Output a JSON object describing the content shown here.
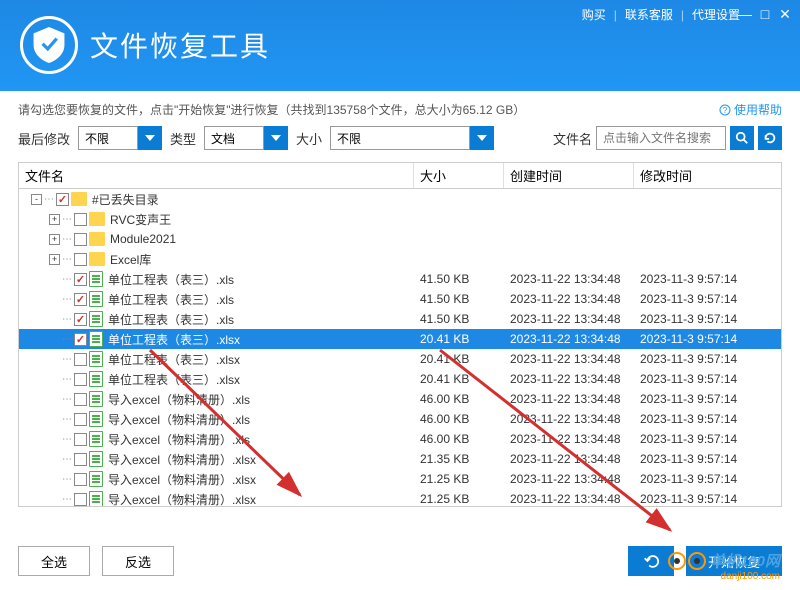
{
  "top_links": {
    "buy": "购买",
    "contact": "联系客服",
    "proxy": "代理设置"
  },
  "app_title": "文件恢复工具",
  "hint": "请勾选您要恢复的文件，点击\"开始恢复\"进行恢复（共找到135758个文件，总大小为65.12 GB）",
  "help": "使用帮助",
  "filters": {
    "last_modified_label": "最后修改",
    "last_modified_value": "不限",
    "type_label": "类型",
    "type_value": "文档",
    "size_label": "大小",
    "size_value": "不限",
    "filename_label": "文件名",
    "search_placeholder": "点击输入文件名搜索"
  },
  "columns": {
    "name": "文件名",
    "size": "大小",
    "created": "创建时间",
    "modified": "修改时间"
  },
  "tree": [
    {
      "depth": 0,
      "type": "folder",
      "expand": "-",
      "checked": true,
      "name": "#已丢失目录",
      "size": "",
      "created": "",
      "modified": "",
      "selected": false
    },
    {
      "depth": 1,
      "type": "folder",
      "expand": "+",
      "checked": false,
      "name": "RVC变声王",
      "size": "",
      "created": "",
      "modified": "",
      "selected": false
    },
    {
      "depth": 1,
      "type": "folder",
      "expand": "+",
      "checked": false,
      "name": "Module2021",
      "size": "",
      "created": "",
      "modified": "",
      "selected": false
    },
    {
      "depth": 1,
      "type": "folder",
      "expand": "+",
      "checked": false,
      "name": "Excel库",
      "size": "",
      "created": "",
      "modified": "",
      "selected": false
    },
    {
      "depth": 1,
      "type": "file",
      "expand": "",
      "checked": true,
      "name": "单位工程表（表三）.xls",
      "size": "41.50 KB",
      "created": "2023-11-22 13:34:48",
      "modified": "2023-11-3 9:57:14",
      "selected": false
    },
    {
      "depth": 1,
      "type": "file",
      "expand": "",
      "checked": true,
      "name": "单位工程表（表三）.xls",
      "size": "41.50 KB",
      "created": "2023-11-22 13:34:48",
      "modified": "2023-11-3 9:57:14",
      "selected": false
    },
    {
      "depth": 1,
      "type": "file",
      "expand": "",
      "checked": true,
      "name": "单位工程表（表三）.xls",
      "size": "41.50 KB",
      "created": "2023-11-22 13:34:48",
      "modified": "2023-11-3 9:57:14",
      "selected": false
    },
    {
      "depth": 1,
      "type": "file",
      "expand": "",
      "checked": true,
      "name": "单位工程表（表三）.xlsx",
      "size": "20.41 KB",
      "created": "2023-11-22 13:34:48",
      "modified": "2023-11-3 9:57:14",
      "selected": true
    },
    {
      "depth": 1,
      "type": "file",
      "expand": "",
      "checked": false,
      "name": "单位工程表（表三）.xlsx",
      "size": "20.41 KB",
      "created": "2023-11-22 13:34:48",
      "modified": "2023-11-3 9:57:14",
      "selected": false
    },
    {
      "depth": 1,
      "type": "file",
      "expand": "",
      "checked": false,
      "name": "单位工程表（表三）.xlsx",
      "size": "20.41 KB",
      "created": "2023-11-22 13:34:48",
      "modified": "2023-11-3 9:57:14",
      "selected": false
    },
    {
      "depth": 1,
      "type": "file",
      "expand": "",
      "checked": false,
      "name": "导入excel（物料清册）.xls",
      "size": "46.00 KB",
      "created": "2023-11-22 13:34:48",
      "modified": "2023-11-3 9:57:14",
      "selected": false
    },
    {
      "depth": 1,
      "type": "file",
      "expand": "",
      "checked": false,
      "name": "导入excel（物料清册）.xls",
      "size": "46.00 KB",
      "created": "2023-11-22 13:34:48",
      "modified": "2023-11-3 9:57:14",
      "selected": false
    },
    {
      "depth": 1,
      "type": "file",
      "expand": "",
      "checked": false,
      "name": "导入excel（物料清册）.xls",
      "size": "46.00 KB",
      "created": "2023-11-22 13:34:48",
      "modified": "2023-11-3 9:57:14",
      "selected": false
    },
    {
      "depth": 1,
      "type": "file",
      "expand": "",
      "checked": false,
      "name": "导入excel（物料清册）.xlsx",
      "size": "21.35 KB",
      "created": "2023-11-22 13:34:48",
      "modified": "2023-11-3 9:57:14",
      "selected": false
    },
    {
      "depth": 1,
      "type": "file",
      "expand": "",
      "checked": false,
      "name": "导入excel（物料清册）.xlsx",
      "size": "21.25 KB",
      "created": "2023-11-22 13:34:48",
      "modified": "2023-11-3 9:57:14",
      "selected": false
    },
    {
      "depth": 1,
      "type": "file",
      "expand": "",
      "checked": false,
      "name": "导入excel（物料清册）.xlsx",
      "size": "21.25 KB",
      "created": "2023-11-22 13:34:48",
      "modified": "2023-11-3 9:57:14",
      "selected": false
    }
  ],
  "footer": {
    "select_all": "全选",
    "invert": "反选",
    "start": "开始恢复"
  },
  "watermark": {
    "name": "单机100网",
    "url": "danji100.com"
  }
}
